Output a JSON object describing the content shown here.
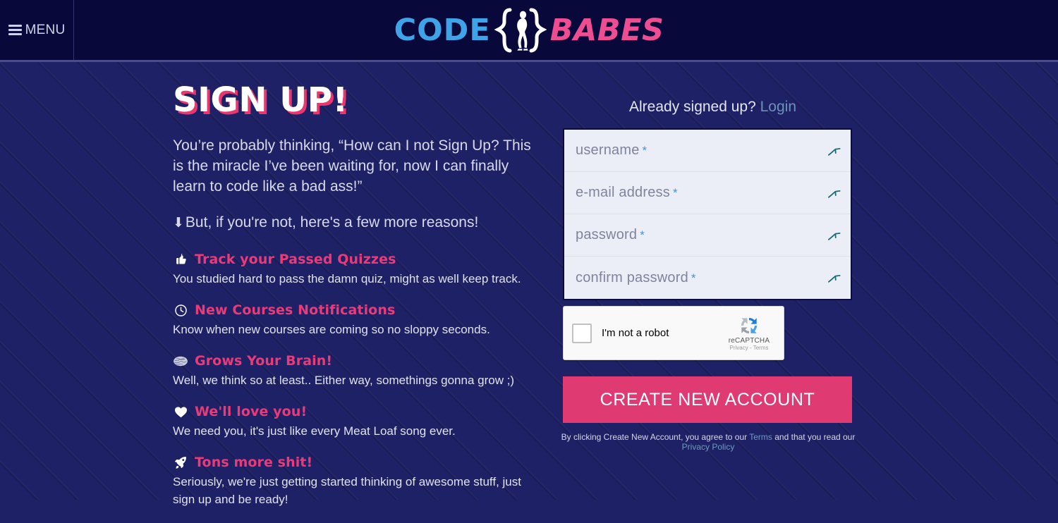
{
  "header": {
    "menu_label": "MENU",
    "menu_icon": "hamburger-icon",
    "logo": {
      "code_text": "CODE",
      "babes_text": "BABES",
      "brace_icon": "curly-brace-woman-icon",
      "code_color": "#3fa3e8",
      "babes_color": "#ee4d91"
    },
    "background_color": "#08083a"
  },
  "left": {
    "title": "SIGN UP!",
    "lead": "You’re probably thinking, “How can I not Sign Up? This is the miracle I’ve been waiting for, now I can finally learn to code like a bad ass!”",
    "sub_arrow_icon": "arrow-down-icon",
    "sub": "But, if you're not, here's a few more reasons!",
    "features": [
      {
        "icon": "thumbs-up-icon",
        "title": "Track your Passed Quizzes",
        "desc": "You studied hard to pass the damn quiz, might as well keep track."
      },
      {
        "icon": "clock-icon",
        "title": "New Courses Notifications",
        "desc": "Know when new courses are coming so no sloppy seconds."
      },
      {
        "icon": "brain-icon",
        "title": "Grows Your Brain!",
        "desc": "Well, we think so at least.. Either way, somethings gonna grow ;)"
      },
      {
        "icon": "heart-icon",
        "title": "We'll love you!",
        "desc": "We need you, it's just like every Meat Loaf song ever."
      },
      {
        "icon": "rocket-icon",
        "title": "Tons more shit!",
        "desc": "Seriously, we're just getting started thinking of awesome stuff, just sign up and be ready!"
      }
    ]
  },
  "right": {
    "already_text": "Already signed up?",
    "login_label": "Login",
    "fields": [
      {
        "placeholder": "username",
        "required_mark": "*",
        "value": "",
        "icon": "bird-check-icon"
      },
      {
        "placeholder": "e-mail address",
        "required_mark": "*",
        "value": "",
        "icon": "bird-check-icon"
      },
      {
        "placeholder": "password",
        "required_mark": "*",
        "value": "",
        "icon": "bird-check-icon"
      },
      {
        "placeholder": "confirm password",
        "required_mark": "*",
        "value": "",
        "icon": "bird-check-icon"
      }
    ],
    "captcha": {
      "checkbox_state": "unchecked",
      "label": "I'm not a robot",
      "brand": "reCAPTCHA",
      "legal": "Privacy - Terms",
      "logo_icon": "recaptcha-icon"
    },
    "cta_label": "CREATE NEW ACCOUNT",
    "cta_color": "#e03a73",
    "legal": {
      "part1": "By clicking Create New Account, you agree to our ",
      "terms_label": "Terms",
      "part2": " and that you read our ",
      "privacy_label": "Privacy Policy"
    }
  },
  "theme": {
    "page_bg": "#1f2166",
    "pink": "#ec3a78",
    "blue": "#3fa3e8",
    "field_bg": "#eceef7"
  }
}
